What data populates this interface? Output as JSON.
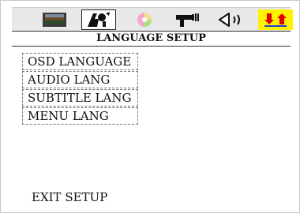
{
  "tabs": [
    {
      "icon": "tv-icon",
      "active": false
    },
    {
      "icon": "settings-person-icon",
      "active": true
    },
    {
      "icon": "disc-icon",
      "active": false
    },
    {
      "icon": "speaker-setup-icon",
      "active": false
    },
    {
      "icon": "audio-speaker-icon",
      "active": false
    },
    {
      "icon": "up-down-arrows-icon",
      "selected": true
    }
  ],
  "colors": {
    "highlight": "#fff200",
    "tabbar": "#e8e8e8",
    "arrow_red": "#e00000",
    "arrow_blue": "#1f3fd6"
  },
  "page": {
    "title": "LANGUAGE SETUP"
  },
  "menu": {
    "items": [
      {
        "label": "OSD LANGUAGE"
      },
      {
        "label": "AUDIO LANG"
      },
      {
        "label": "SUBTITLE LANG"
      },
      {
        "label": "MENU LANG"
      }
    ]
  },
  "footer": {
    "exit_label": "EXIT SETUP"
  }
}
